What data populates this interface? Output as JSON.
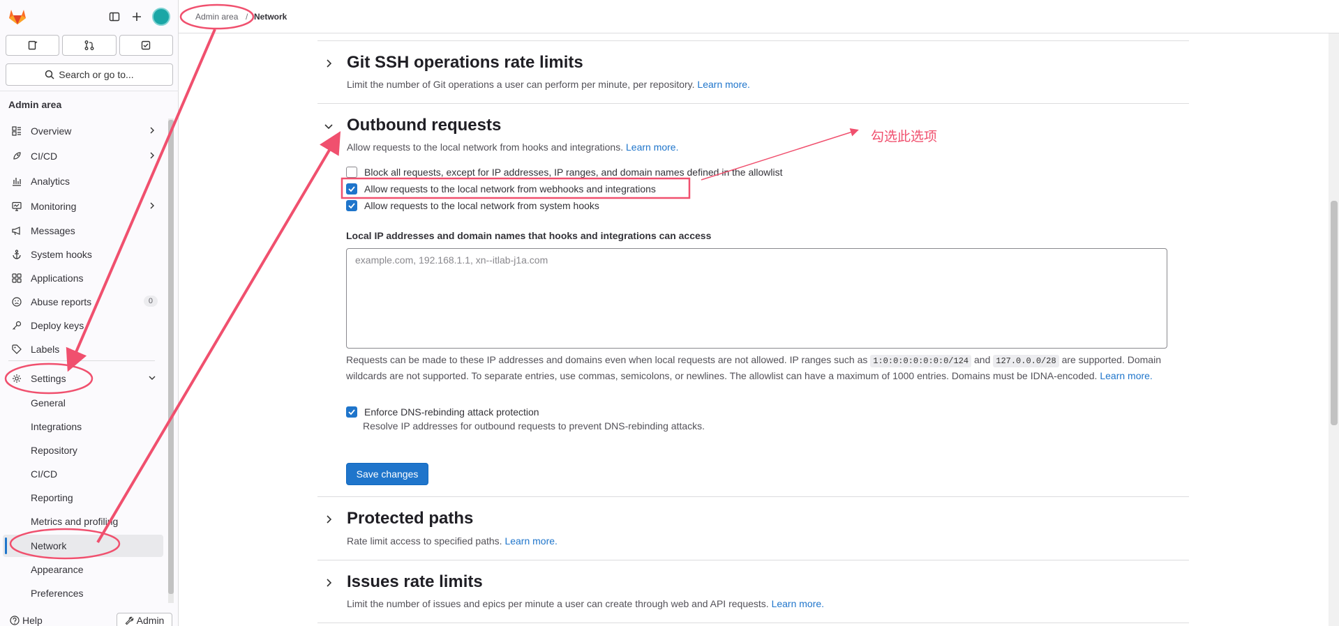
{
  "sidebar": {
    "search_label": "Search or go to...",
    "section_title": "Admin area",
    "items": [
      {
        "label": "Overview"
      },
      {
        "label": "CI/CD"
      },
      {
        "label": "Analytics"
      },
      {
        "label": "Monitoring"
      },
      {
        "label": "Messages"
      },
      {
        "label": "System hooks"
      },
      {
        "label": "Applications"
      },
      {
        "label": "Abuse reports",
        "badge": "0"
      },
      {
        "label": "Deploy keys"
      },
      {
        "label": "Labels"
      },
      {
        "label": "Settings"
      }
    ],
    "settings_sub": [
      {
        "label": "General"
      },
      {
        "label": "Integrations"
      },
      {
        "label": "Repository"
      },
      {
        "label": "CI/CD"
      },
      {
        "label": "Reporting"
      },
      {
        "label": "Metrics and profiling"
      },
      {
        "label": "Network"
      },
      {
        "label": "Appearance"
      },
      {
        "label": "Preferences"
      }
    ],
    "help_label": "Help",
    "admin_label": "Admin"
  },
  "breadcrumb": {
    "parent": "Admin area",
    "separator": "/",
    "current": "Network"
  },
  "sections": {
    "git_ssh": {
      "title": "Git SSH operations rate limits",
      "desc": "Limit the number of Git operations a user can perform per minute, per repository.",
      "link": "Learn more."
    },
    "outbound": {
      "title": "Outbound requests",
      "desc": "Allow requests to the local network from hooks and integrations.",
      "link": "Learn more.",
      "checkboxes": [
        {
          "label": "Block all requests, except for IP addresses, IP ranges, and domain names defined in the allowlist",
          "checked": false
        },
        {
          "label": "Allow requests to the local network from webhooks and integrations",
          "checked": true
        },
        {
          "label": "Allow requests to the local network from system hooks",
          "checked": true
        }
      ],
      "field_label": "Local IP addresses and domain names that hooks and integrations can access",
      "field_placeholder": "example.com, 192.168.1.1, xn--itlab-j1a.com",
      "help_1": "Requests can be made to these IP addresses and domains even when local requests are not allowed. IP ranges such as",
      "code_1": "1:0:0:0:0:0:0:0/124",
      "help_and": "and",
      "code_2": "127.0.0.0/28",
      "help_2": "are supported. Domain wildcards are not supported. To separate entries, use commas, semicolons, or newlines. The allowlist can have a maximum of 1000 entries. Domains must be IDNA-encoded.",
      "help_link": "Learn more.",
      "dns_label": "Enforce DNS-rebinding attack protection",
      "dns_checked": true,
      "dns_help": "Resolve IP addresses for outbound requests to prevent DNS-rebinding attacks.",
      "save_label": "Save changes"
    },
    "protected_paths": {
      "title": "Protected paths",
      "desc": "Rate limit access to specified paths.",
      "link": "Learn more."
    },
    "issues": {
      "title": "Issues rate limits",
      "desc": "Limit the number of issues and epics per minute a user can create through web and API requests.",
      "link": "Learn more."
    }
  },
  "annotation": {
    "note": "勾选此选项",
    "color": "#f0506e"
  },
  "colors": {
    "accent": "#1f75cb",
    "sidebar_bg": "#fbfafd"
  }
}
